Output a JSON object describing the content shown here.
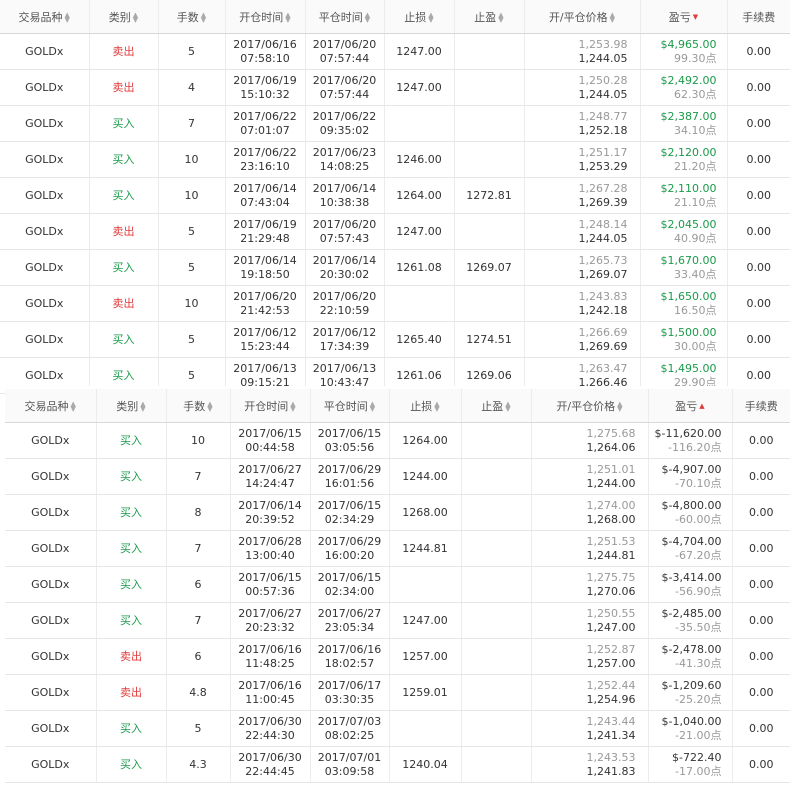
{
  "headers": [
    "交易品种",
    "类别",
    "手数",
    "开仓时间",
    "平仓时间",
    "止损",
    "止盈",
    "开/平仓价格",
    "盈亏",
    "手续费"
  ],
  "table_top": {
    "sort_dir": "desc",
    "rows": [
      {
        "symbol": "GOLDx",
        "type": "卖出",
        "side": "sell",
        "lots": "5",
        "open_date": "2017/06/16",
        "open_time": "07:58:10",
        "close_date": "2017/06/20",
        "close_time": "07:57:44",
        "sl": "1247.00",
        "tp": "",
        "open_price": "1,253.98",
        "close_price": "1,244.05",
        "profit": "$4,965.00",
        "points": "99.30点",
        "fee": "0.00"
      },
      {
        "symbol": "GOLDx",
        "type": "卖出",
        "side": "sell",
        "lots": "4",
        "open_date": "2017/06/19",
        "open_time": "15:10:32",
        "close_date": "2017/06/20",
        "close_time": "07:57:44",
        "sl": "1247.00",
        "tp": "",
        "open_price": "1,250.28",
        "close_price": "1,244.05",
        "profit": "$2,492.00",
        "points": "62.30点",
        "fee": "0.00"
      },
      {
        "symbol": "GOLDx",
        "type": "买入",
        "side": "buy",
        "lots": "7",
        "open_date": "2017/06/22",
        "open_time": "07:01:07",
        "close_date": "2017/06/22",
        "close_time": "09:35:02",
        "sl": "",
        "tp": "",
        "open_price": "1,248.77",
        "close_price": "1,252.18",
        "profit": "$2,387.00",
        "points": "34.10点",
        "fee": "0.00"
      },
      {
        "symbol": "GOLDx",
        "type": "买入",
        "side": "buy",
        "lots": "10",
        "open_date": "2017/06/22",
        "open_time": "23:16:10",
        "close_date": "2017/06/23",
        "close_time": "14:08:25",
        "sl": "1246.00",
        "tp": "",
        "open_price": "1,251.17",
        "close_price": "1,253.29",
        "profit": "$2,120.00",
        "points": "21.20点",
        "fee": "0.00"
      },
      {
        "symbol": "GOLDx",
        "type": "买入",
        "side": "buy",
        "lots": "10",
        "open_date": "2017/06/14",
        "open_time": "07:43:04",
        "close_date": "2017/06/14",
        "close_time": "10:38:38",
        "sl": "1264.00",
        "tp": "1272.81",
        "open_price": "1,267.28",
        "close_price": "1,269.39",
        "profit": "$2,110.00",
        "points": "21.10点",
        "fee": "0.00"
      },
      {
        "symbol": "GOLDx",
        "type": "卖出",
        "side": "sell",
        "lots": "5",
        "open_date": "2017/06/19",
        "open_time": "21:29:48",
        "close_date": "2017/06/20",
        "close_time": "07:57:43",
        "sl": "1247.00",
        "tp": "",
        "open_price": "1,248.14",
        "close_price": "1,244.05",
        "profit": "$2,045.00",
        "points": "40.90点",
        "fee": "0.00"
      },
      {
        "symbol": "GOLDx",
        "type": "买入",
        "side": "buy",
        "lots": "5",
        "open_date": "2017/06/14",
        "open_time": "19:18:50",
        "close_date": "2017/06/14",
        "close_time": "20:30:02",
        "sl": "1261.08",
        "tp": "1269.07",
        "open_price": "1,265.73",
        "close_price": "1,269.07",
        "profit": "$1,670.00",
        "points": "33.40点",
        "fee": "0.00"
      },
      {
        "symbol": "GOLDx",
        "type": "卖出",
        "side": "sell",
        "lots": "10",
        "open_date": "2017/06/20",
        "open_time": "21:42:53",
        "close_date": "2017/06/20",
        "close_time": "22:10:59",
        "sl": "",
        "tp": "",
        "open_price": "1,243.83",
        "close_price": "1,242.18",
        "profit": "$1,650.00",
        "points": "16.50点",
        "fee": "0.00"
      },
      {
        "symbol": "GOLDx",
        "type": "买入",
        "side": "buy",
        "lots": "5",
        "open_date": "2017/06/12",
        "open_time": "15:23:44",
        "close_date": "2017/06/12",
        "close_time": "17:34:39",
        "sl": "1265.40",
        "tp": "1274.51",
        "open_price": "1,266.69",
        "close_price": "1,269.69",
        "profit": "$1,500.00",
        "points": "30.00点",
        "fee": "0.00"
      },
      {
        "symbol": "GOLDx",
        "type": "买入",
        "side": "buy",
        "lots": "5",
        "open_date": "2017/06/13",
        "open_time": "09:15:21",
        "close_date": "2017/06/13",
        "close_time": "10:43:47",
        "sl": "1261.06",
        "tp": "1269.06",
        "open_price": "1,263.47",
        "close_price": "1,266.46",
        "profit": "$1,495.00",
        "points": "29.90点",
        "fee": "0.00"
      }
    ]
  },
  "table_bottom": {
    "sort_dir": "asc",
    "rows": [
      {
        "symbol": "GOLDx",
        "type": "买入",
        "side": "buy",
        "lots": "10",
        "open_date": "2017/06/15",
        "open_time": "00:44:58",
        "close_date": "2017/06/15",
        "close_time": "03:05:56",
        "sl": "1264.00",
        "tp": "",
        "open_price": "1,275.68",
        "close_price": "1,264.06",
        "profit": "$-11,620.00",
        "points": "-116.20点",
        "fee": "0.00"
      },
      {
        "symbol": "GOLDx",
        "type": "买入",
        "side": "buy",
        "lots": "7",
        "open_date": "2017/06/27",
        "open_time": "14:24:47",
        "close_date": "2017/06/29",
        "close_time": "16:01:56",
        "sl": "1244.00",
        "tp": "",
        "open_price": "1,251.01",
        "close_price": "1,244.00",
        "profit": "$-4,907.00",
        "points": "-70.10点",
        "fee": "0.00"
      },
      {
        "symbol": "GOLDx",
        "type": "买入",
        "side": "buy",
        "lots": "8",
        "open_date": "2017/06/14",
        "open_time": "20:39:52",
        "close_date": "2017/06/15",
        "close_time": "02:34:29",
        "sl": "1268.00",
        "tp": "",
        "open_price": "1,274.00",
        "close_price": "1,268.00",
        "profit": "$-4,800.00",
        "points": "-60.00点",
        "fee": "0.00"
      },
      {
        "symbol": "GOLDx",
        "type": "买入",
        "side": "buy",
        "lots": "7",
        "open_date": "2017/06/28",
        "open_time": "13:00:40",
        "close_date": "2017/06/29",
        "close_time": "16:00:20",
        "sl": "1244.81",
        "tp": "",
        "open_price": "1,251.53",
        "close_price": "1,244.81",
        "profit": "$-4,704.00",
        "points": "-67.20点",
        "fee": "0.00"
      },
      {
        "symbol": "GOLDx",
        "type": "买入",
        "side": "buy",
        "lots": "6",
        "open_date": "2017/06/15",
        "open_time": "00:57:36",
        "close_date": "2017/06/15",
        "close_time": "02:34:00",
        "sl": "",
        "tp": "",
        "open_price": "1,275.75",
        "close_price": "1,270.06",
        "profit": "$-3,414.00",
        "points": "-56.90点",
        "fee": "0.00"
      },
      {
        "symbol": "GOLDx",
        "type": "买入",
        "side": "buy",
        "lots": "7",
        "open_date": "2017/06/27",
        "open_time": "20:23:32",
        "close_date": "2017/06/27",
        "close_time": "23:05:34",
        "sl": "1247.00",
        "tp": "",
        "open_price": "1,250.55",
        "close_price": "1,247.00",
        "profit": "$-2,485.00",
        "points": "-35.50点",
        "fee": "0.00"
      },
      {
        "symbol": "GOLDx",
        "type": "卖出",
        "side": "sell",
        "lots": "6",
        "open_date": "2017/06/16",
        "open_time": "11:48:25",
        "close_date": "2017/06/16",
        "close_time": "18:02:57",
        "sl": "1257.00",
        "tp": "",
        "open_price": "1,252.87",
        "close_price": "1,257.00",
        "profit": "$-2,478.00",
        "points": "-41.30点",
        "fee": "0.00"
      },
      {
        "symbol": "GOLDx",
        "type": "卖出",
        "side": "sell",
        "lots": "4.8",
        "open_date": "2017/06/16",
        "open_time": "11:00:45",
        "close_date": "2017/06/17",
        "close_time": "03:30:35",
        "sl": "1259.01",
        "tp": "",
        "open_price": "1,252.44",
        "close_price": "1,254.96",
        "profit": "$-1,209.60",
        "points": "-25.20点",
        "fee": "0.00"
      },
      {
        "symbol": "GOLDx",
        "type": "买入",
        "side": "buy",
        "lots": "5",
        "open_date": "2017/06/30",
        "open_time": "22:44:30",
        "close_date": "2017/07/03",
        "close_time": "08:02:25",
        "sl": "",
        "tp": "",
        "open_price": "1,243.44",
        "close_price": "1,241.34",
        "profit": "$-1,040.00",
        "points": "-21.00点",
        "fee": "0.00"
      },
      {
        "symbol": "GOLDx",
        "type": "买入",
        "side": "buy",
        "lots": "4.3",
        "open_date": "2017/06/30",
        "open_time": "22:44:45",
        "close_date": "2017/07/01",
        "close_time": "03:09:58",
        "sl": "1240.04",
        "tp": "",
        "open_price": "1,243.53",
        "close_price": "1,241.83",
        "profit": "$-722.40",
        "points": "-17.00点",
        "fee": "0.00"
      }
    ]
  }
}
